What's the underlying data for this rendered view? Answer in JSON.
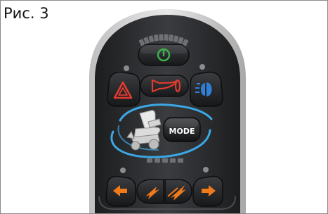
{
  "figure": {
    "label": "Рис. 3"
  },
  "controller": {
    "mode_button_label": "MODE",
    "battery_gauge_segments": 10,
    "speed_gauge_segments": 5,
    "icons": {
      "power": "power-icon",
      "hazard": "hazard-warning-icon",
      "horn": "horn-icon",
      "lights": "headlight-icon",
      "wheelchair": "wheelchair-icon",
      "left_indicator": "arrow-left-icon",
      "right_indicator": "arrow-right-icon",
      "speed_down": "speed-decrease-icon",
      "speed_up": "speed-increase-icon"
    },
    "colors": {
      "body": "#2b2d2f",
      "button": "#1f2022",
      "accent_blue": "#3ba8e6",
      "hazard_red": "#e23a2f",
      "power_green": "#3fb34a",
      "indicator_orange": "#f07a1a",
      "headlight_blue": "#2f7fd6"
    }
  }
}
